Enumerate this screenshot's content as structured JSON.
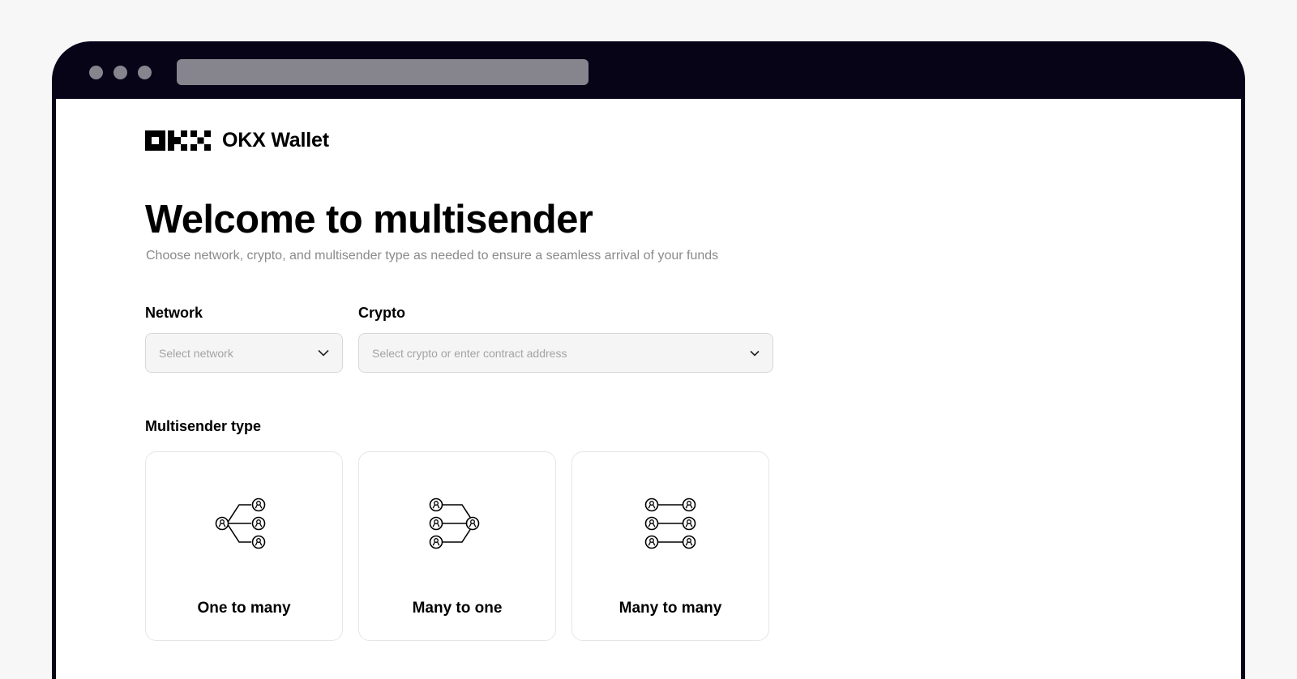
{
  "browser": {
    "window_controls": [
      "dot",
      "dot",
      "dot"
    ]
  },
  "header": {
    "logo_text": "OKX Wallet"
  },
  "main": {
    "title": "Welcome to multisender",
    "subtitle": "Choose network, crypto, and multisender type as needed to ensure a seamless arrival of your funds",
    "network": {
      "label": "Network",
      "placeholder": "Select network"
    },
    "crypto": {
      "label": "Crypto",
      "placeholder": "Select crypto or enter contract address"
    },
    "multisender_type": {
      "label": "Multisender type",
      "options": [
        {
          "label": "One to many",
          "icon": "one-to-many-icon"
        },
        {
          "label": "Many to one",
          "icon": "many-to-one-icon"
        },
        {
          "label": "Many to many",
          "icon": "many-to-many-icon"
        }
      ]
    }
  },
  "colors": {
    "browser_frame": "#070418",
    "placeholder_text": "#a3a3a3",
    "subtitle_text": "#8a8a8a",
    "input_bg": "#f5f5f5"
  }
}
